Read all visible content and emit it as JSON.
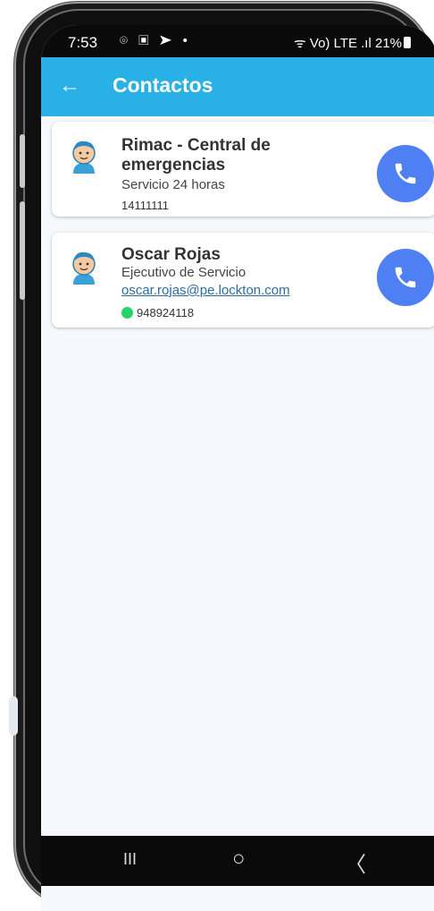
{
  "status_bar": {
    "time": "7:53",
    "left_icons": "⌾ ▣ ➤ •",
    "right_text": "ᯤ Vo) LTE .ıl 21%"
  },
  "app_bar": {
    "back_glyph": "←",
    "title": "Contactos"
  },
  "contacts": [
    {
      "name": "Rimac - Central de emergencias",
      "subtitle": "Servicio 24 horas",
      "phone": "14111111"
    },
    {
      "name": "Oscar Rojas",
      "subtitle": "Ejecutivo de Servicio",
      "email": "oscar.rojas@pe.lockton.com",
      "phone": "948924118",
      "whatsapp": true
    }
  ],
  "nav": {
    "recents": "III",
    "home": "○",
    "back": "〈"
  },
  "colors": {
    "app_bar": "#29b1e7",
    "call_button": "#4e7ff3",
    "whatsapp": "#25d366",
    "link": "#2b6da3"
  }
}
